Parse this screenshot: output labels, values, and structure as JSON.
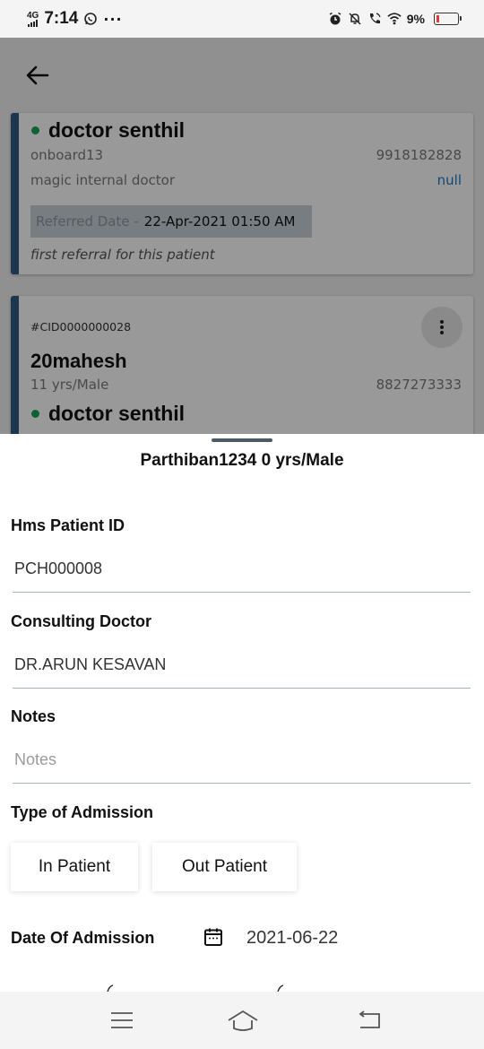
{
  "status_bar": {
    "network": "4G",
    "time": "7:14",
    "overflow": "···",
    "battery_percent": "9%",
    "battery_level": 0.09,
    "battery_color": "#e53935",
    "icons": [
      "signal-bars-icon",
      "whatsapp-icon",
      "alarm-icon",
      "dnd-bell-off-icon",
      "wifi-calling-icon",
      "wifi-icon",
      "battery-icon"
    ]
  },
  "background_page": {
    "back_icon": "arrow-left-icon",
    "referral_card": {
      "doctor_name": "doctor senthil",
      "username": "onboard13",
      "phone": "9918182828",
      "hospital": "magic internal doctor",
      "link": "null",
      "referred_label": "Referred Date -",
      "referred_value": "22-Apr-2021 01:50 AM",
      "note": "first referral for this patient"
    },
    "patient_card": {
      "case_id": "#CID0000000028",
      "patient_name": "20mahesh",
      "age_gender": "11 yrs/Male",
      "phone": "8827273333",
      "doctor_name": "doctor senthil",
      "more_icon": "more-vertical-icon"
    }
  },
  "sheet": {
    "title": "Parthiban1234 0 yrs/Male",
    "fields": {
      "hms_patient_id": {
        "label": "Hms Patient ID",
        "value": "PCH000008"
      },
      "consulting_doctor": {
        "label": "Consulting Doctor",
        "value": "DR.ARUN KESAVAN"
      },
      "notes": {
        "label": "Notes",
        "placeholder": "Notes"
      }
    },
    "admission_type": {
      "label": "Type of Admission",
      "options": [
        "In Patient",
        "Out Patient"
      ]
    },
    "date_of_admission": {
      "label": "Date Of Admission",
      "value": "2021-06-22",
      "icon": "calendar-icon"
    }
  },
  "nav_bar": {
    "icons": [
      "menu-icon",
      "home-icon",
      "back-icon"
    ]
  },
  "colors": {
    "accent": "#2d5b80",
    "online_dot": "#19a35a",
    "link": "#1d79c4",
    "underline": "#a6b3bf"
  }
}
